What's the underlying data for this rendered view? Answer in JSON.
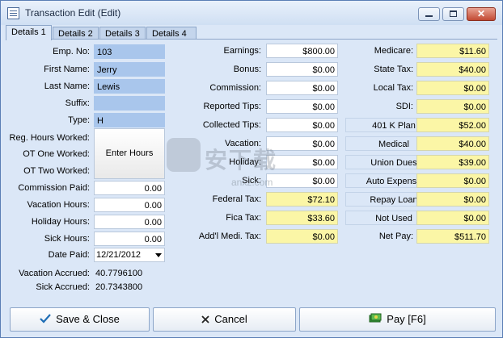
{
  "window": {
    "title": "Transaction Edit (Edit)"
  },
  "tabs": [
    "Details 1",
    "Details 2",
    "Details 3",
    "Details 4"
  ],
  "employee": {
    "emp_no_label": "Emp. No:",
    "emp_no": "103",
    "first_name_label": "First Name:",
    "first_name": "Jerry",
    "last_name_label": "Last Name:",
    "last_name": "Lewis",
    "suffix_label": "Suffix:",
    "suffix": "",
    "type_label": "Type:",
    "type": "H"
  },
  "hours": {
    "reg_label": "Reg. Hours Worked:",
    "ot_one_label": "OT One Worked:",
    "ot_two_label": "OT Two Worked:",
    "enter_hours_button": "Enter Hours",
    "commission_paid_label": "Commission Paid:",
    "commission_paid": "0.00",
    "vacation_label": "Vacation Hours:",
    "vacation": "0.00",
    "holiday_label": "Holiday Hours:",
    "holiday": "0.00",
    "sick_label": "Sick Hours:",
    "sick": "0.00",
    "date_paid_label": "Date Paid:",
    "date_paid": "12/21/2012",
    "vacation_accrued_label": "Vacation Accrued:",
    "vacation_accrued": "40.7796100",
    "sick_accrued_label": "Sick Accrued:",
    "sick_accrued": "20.7343800"
  },
  "earnings": [
    {
      "label": "Earnings:",
      "value": "$800.00",
      "style": "white"
    },
    {
      "label": "Bonus:",
      "value": "$0.00",
      "style": "white"
    },
    {
      "label": "Commission:",
      "value": "$0.00",
      "style": "white"
    },
    {
      "label": "Reported Tips:",
      "value": "$0.00",
      "style": "white"
    },
    {
      "label": "Collected Tips:",
      "value": "$0.00",
      "style": "white"
    },
    {
      "label": "Vacation:",
      "value": "$0.00",
      "style": "white"
    },
    {
      "label": "Holiday:",
      "value": "$0.00",
      "style": "white"
    },
    {
      "label": "Sick:",
      "value": "$0.00",
      "style": "white"
    },
    {
      "label": "Federal Tax:",
      "value": "$72.10",
      "style": "yellow"
    },
    {
      "label": "Fica Tax:",
      "value": "$33.60",
      "style": "yellow"
    },
    {
      "label": "Add'l Medi. Tax:",
      "value": "$0.00",
      "style": "yellow"
    }
  ],
  "taxes": [
    {
      "label": "Medicare:",
      "value": "$11.60"
    },
    {
      "label": "State Tax:",
      "value": "$40.00"
    },
    {
      "label": "Local Tax:",
      "value": "$0.00"
    },
    {
      "label": "SDI:",
      "value": "$0.00"
    }
  ],
  "deductions": [
    {
      "label": "401 K Plan",
      "value": "$52.00"
    },
    {
      "label": "Medical",
      "value": "$40.00"
    },
    {
      "label": "Union Dues",
      "value": "$39.00"
    },
    {
      "label": "Auto Expense",
      "value": "$0.00"
    },
    {
      "label": "Repay Loan",
      "value": "$0.00"
    },
    {
      "label": "Not Used",
      "value": "$0.00"
    }
  ],
  "net_pay": {
    "label": "Net Pay:",
    "value": "$511.70"
  },
  "buttons": {
    "save": "Save & Close",
    "cancel": "Cancel",
    "pay": "Pay [F6]"
  },
  "watermark": {
    "text": "安下载",
    "sub": "anxz.com"
  },
  "colors": {
    "blue_field": "#a9c6ec",
    "yellow_field": "#fbf6a6",
    "window_bg": "#dbe7f7"
  }
}
